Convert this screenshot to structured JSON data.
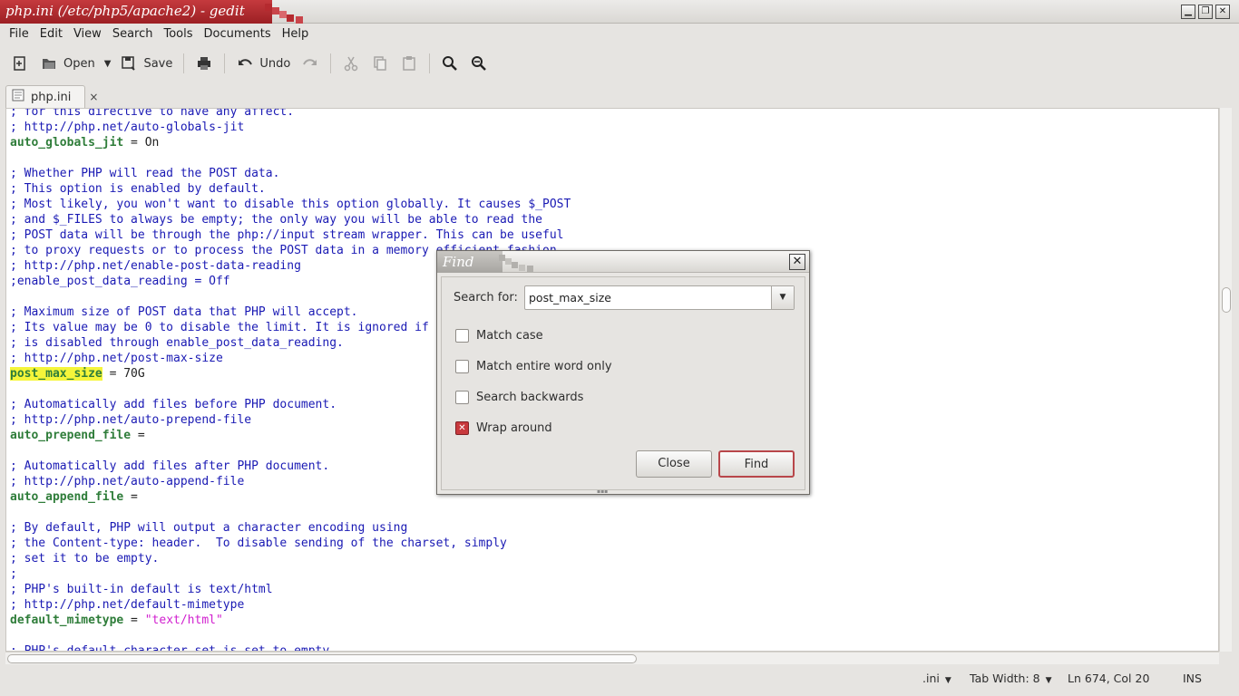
{
  "window": {
    "title": "php.ini (/etc/php5/apache2) - gedit",
    "controls": {
      "minimize": "▁",
      "maximize": "❐",
      "close": "✕"
    }
  },
  "menubar": [
    "File",
    "Edit",
    "View",
    "Search",
    "Tools",
    "Documents",
    "Help"
  ],
  "toolbar": {
    "open_label": "Open",
    "save_label": "Save",
    "undo_label": "Undo"
  },
  "tab": {
    "label": "php.ini",
    "close": "×"
  },
  "editor": {
    "lines": [
      [
        {
          "t": "cm",
          "s": "; for this directive to have any affect."
        }
      ],
      [
        {
          "t": "cm",
          "s": "; http://php.net/auto-globals-jit"
        }
      ],
      [
        {
          "t": "kw",
          "s": "auto_globals_jit"
        },
        {
          "t": "tx",
          "s": " = On"
        }
      ],
      [],
      [
        {
          "t": "cm",
          "s": "; Whether PHP will read the POST data."
        }
      ],
      [
        {
          "t": "cm",
          "s": "; This option is enabled by default."
        }
      ],
      [
        {
          "t": "cm",
          "s": "; Most likely, you won't want to disable this option globally. It causes $_POST"
        }
      ],
      [
        {
          "t": "cm",
          "s": "; and $_FILES to always be empty; the only way you will be able to read the"
        }
      ],
      [
        {
          "t": "cm",
          "s": "; POST data will be through the php://input stream wrapper. This can be useful"
        }
      ],
      [
        {
          "t": "cm",
          "s": "; to proxy requests or to process the POST data in a memory efficient fashion."
        }
      ],
      [
        {
          "t": "cm",
          "s": "; http://php.net/enable-post-data-reading"
        }
      ],
      [
        {
          "t": "cm",
          "s": ";enable_post_data_reading = Off"
        }
      ],
      [],
      [
        {
          "t": "cm",
          "s": "; Maximum size of POST data that PHP will accept."
        }
      ],
      [
        {
          "t": "cm",
          "s": "; Its value may be 0 to disable the limit. It is ignored if"
        }
      ],
      [
        {
          "t": "cm",
          "s": "; is disabled through enable_post_data_reading."
        }
      ],
      [
        {
          "t": "cm",
          "s": "; http://php.net/post-max-size"
        }
      ],
      [
        {
          "t": "kw hl",
          "s": "post_max_size"
        },
        {
          "t": "tx",
          "s": " = 70G"
        }
      ],
      [],
      [
        {
          "t": "cm",
          "s": "; Automatically add files before PHP document."
        }
      ],
      [
        {
          "t": "cm",
          "s": "; http://php.net/auto-prepend-file"
        }
      ],
      [
        {
          "t": "kw",
          "s": "auto_prepend_file"
        },
        {
          "t": "tx",
          "s": " ="
        }
      ],
      [],
      [
        {
          "t": "cm",
          "s": "; Automatically add files after PHP document."
        }
      ],
      [
        {
          "t": "cm",
          "s": "; http://php.net/auto-append-file"
        }
      ],
      [
        {
          "t": "kw",
          "s": "auto_append_file"
        },
        {
          "t": "tx",
          "s": " ="
        }
      ],
      [],
      [
        {
          "t": "cm",
          "s": "; By default, PHP will output a character encoding using"
        }
      ],
      [
        {
          "t": "cm",
          "s": "; the Content-type: header.  To disable sending of the charset, simply"
        }
      ],
      [
        {
          "t": "cm",
          "s": "; set it to be empty."
        }
      ],
      [
        {
          "t": "cm",
          "s": ";"
        }
      ],
      [
        {
          "t": "cm",
          "s": "; PHP's built-in default is text/html"
        }
      ],
      [
        {
          "t": "cm",
          "s": "; http://php.net/default-mimetype"
        }
      ],
      [
        {
          "t": "kw",
          "s": "default_mimetype"
        },
        {
          "t": "tx",
          "s": " = "
        },
        {
          "t": "st",
          "s": "\"text/html\""
        }
      ],
      [],
      [
        {
          "t": "cm",
          "s": "; PHP's default character set is set to empty."
        }
      ]
    ]
  },
  "find_dialog": {
    "title": "Find",
    "close_glyph": "✕",
    "search_label": "Search for:",
    "search_value": "post_max_size",
    "options": [
      {
        "label": "Match case",
        "checked": false
      },
      {
        "label": "Match entire word only",
        "checked": false
      },
      {
        "label": "Search backwards",
        "checked": false
      },
      {
        "label": "Wrap around",
        "checked": true
      }
    ],
    "close_button": "Close",
    "find_button": "Find"
  },
  "statusbar": {
    "language": ".ini",
    "tab_width": "Tab Width:  8",
    "position": "Ln 674, Col 20",
    "mode": "INS"
  },
  "colors": {
    "accent": "#b8282d",
    "comment": "#1a1ab4",
    "keyword": "#2f7d3a",
    "string": "#d11fcf",
    "highlight": "#f5f53a"
  }
}
